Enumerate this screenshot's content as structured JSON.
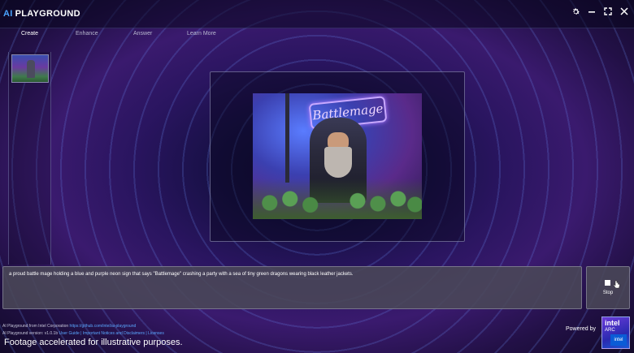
{
  "app": {
    "logo_prefix": "AI",
    "logo_name": "PLAYGROUND"
  },
  "window_controls": {
    "settings_icon": "gear-icon",
    "minimize_icon": "minimize-icon",
    "maximize_icon": "maximize-icon",
    "close_icon": "close-icon"
  },
  "tabs": [
    {
      "label": "Create",
      "active": true
    },
    {
      "label": "Enhance",
      "active": false
    },
    {
      "label": "Answer",
      "active": false
    },
    {
      "label": "Learn More",
      "active": false
    }
  ],
  "canvas": {
    "sign_text": "Battlemage"
  },
  "prompt": {
    "text": "a proud battle mage holding a blue and purple neon sign that says \"Battlemage\" crashing a party with a sea of tiny green dragons wearing black leather jackets."
  },
  "stop_button": {
    "label": "Stop"
  },
  "footer": {
    "line1_prefix": "AI Playground from Intel Corporation",
    "line1_link": "https://github.com/intel/ai-playground",
    "line2_prefix": "AI Playground version: v1.0.1b",
    "line2_links": "User Guide | Important Notices and Disclaimers | Licenses"
  },
  "caption": "Footage accelerated for illustrative purposes.",
  "branding": {
    "powered_by": "Powered by",
    "badge_brand": "intel",
    "badge_product": "ARC",
    "badge_inside": "intel"
  }
}
